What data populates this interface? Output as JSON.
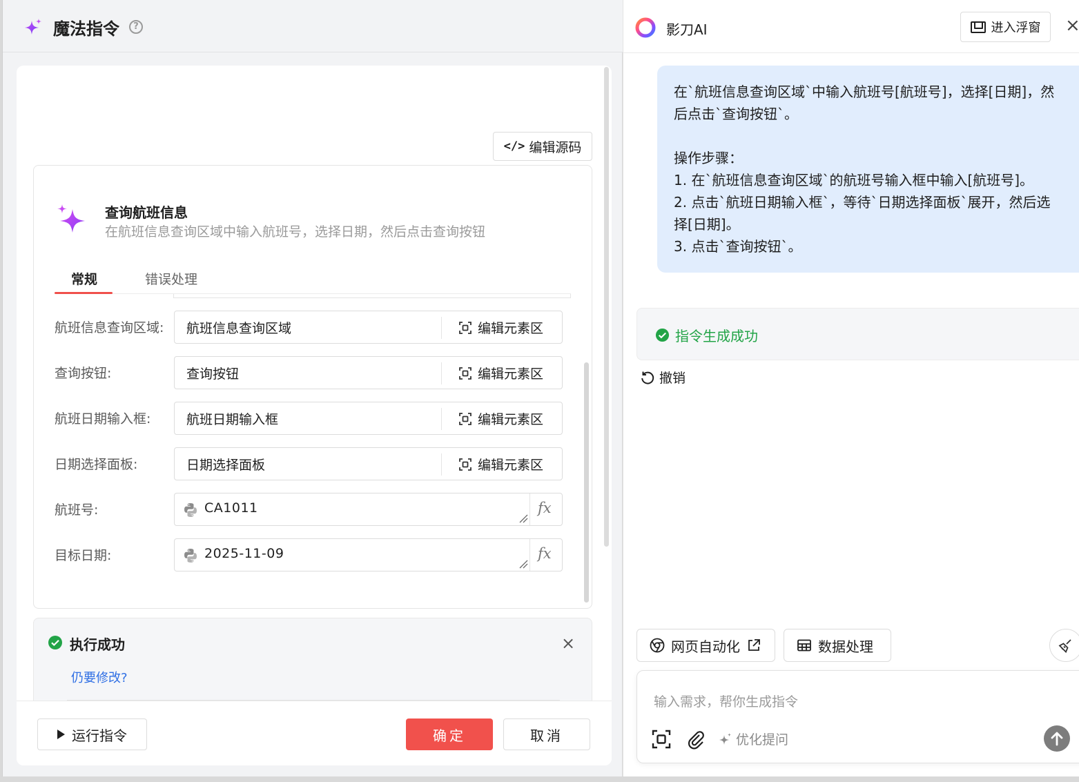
{
  "left_panel": {
    "title": "魔法指令",
    "help_glyph": "?",
    "edit_source_label": "编辑源码",
    "command": {
      "title": "查询航班信息",
      "description": "在航班信息查询区域中输入航班号，选择日期，然后点击查询按钮"
    },
    "tabs": [
      {
        "label": "常规",
        "active": true
      },
      {
        "label": "错误处理",
        "active": false
      }
    ],
    "element_fields": [
      {
        "label": "航班信息查询区域:",
        "value": "航班信息查询区域",
        "action": "编辑元素区"
      },
      {
        "label": "查询按钮:",
        "value": "查询按钮",
        "action": "编辑元素区"
      },
      {
        "label": "航班日期输入框:",
        "value": "航班日期输入框",
        "action": "编辑元素区"
      },
      {
        "label": "日期选择面板:",
        "value": "日期选择面板",
        "action": "编辑元素区"
      }
    ],
    "expression_fields": [
      {
        "label": "航班号:",
        "value": "CA1011",
        "fx": "fx"
      },
      {
        "label": "目标日期:",
        "value": "2025-11-09",
        "fx": "fx"
      }
    ],
    "result": {
      "status": "执行成功",
      "modify_link": "仍要修改?",
      "close_glyph": "×"
    },
    "footer": {
      "run_label": "运行指令",
      "ok_label": "确定",
      "cancel_label": "取消"
    }
  },
  "right_panel": {
    "brand": "影刀AI",
    "float_label": "进入浮窗",
    "close_glyph": "×",
    "message": {
      "intro": "在`航班信息查询区域`中输入航班号[航班号]，选择[日期]，然后点击`查询按钮`。",
      "steps_title": "操作步骤：",
      "steps": [
        "1. 在`航班信息查询区域`的航班号输入框中输入[航班号]。",
        "2. 点击`航班日期输入框`，等待`日期选择面板`展开，然后选择[日期]。",
        "3. 点击`查询按钮`。"
      ]
    },
    "status_text": "指令生成成功",
    "undo_label": "撤销",
    "chips": {
      "web": "网页自动化",
      "data": "数据处理"
    },
    "input": {
      "placeholder": "输入需求，帮你生成指令",
      "optimize_label": "优化提问"
    }
  },
  "colors": {
    "accent_red": "#f1514c",
    "success_green": "#22a447",
    "link_blue": "#2f6fe4",
    "bubble_bg": "#e1edfd",
    "sparkle_purple": "#9b3df5"
  }
}
